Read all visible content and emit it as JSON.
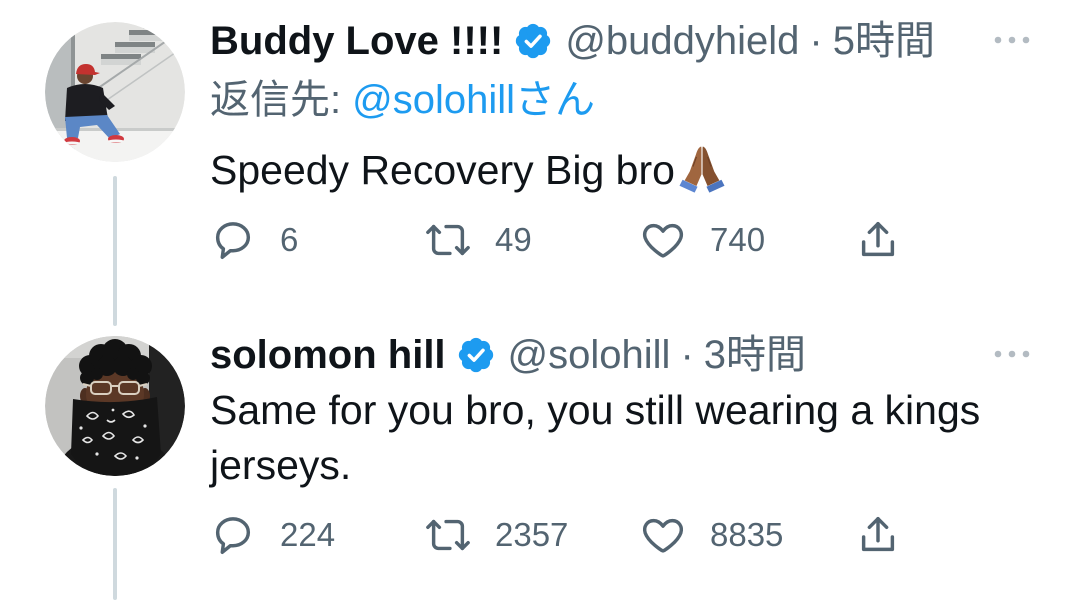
{
  "colors": {
    "background": "#ffffff",
    "text": "#0f1419",
    "secondary": "#536471",
    "link": "#1d9bf0",
    "verified": "#1d9bf0",
    "thread_line": "#cfd9de",
    "more_icon": "#b3bbc2"
  },
  "icons": {
    "more": "more-options-icon",
    "verified": "verified-badge-icon",
    "reply": "reply-icon",
    "retweet": "retweet-icon",
    "like": "heart-icon",
    "share": "share-icon"
  },
  "tweets": [
    {
      "author": {
        "name": "Buddy Love !!!!",
        "handle": "@buddyhield",
        "separator": "·",
        "time": "5時間",
        "avatar": "avatar-buddy-love"
      },
      "reply_to": {
        "label": "返信先:",
        "handle": "@solohillさん"
      },
      "text": "Speedy Recovery Big bro",
      "emoji_icon": "folded-hands-medium-dark-skin-tone-emoji",
      "actions": {
        "replies": "6",
        "retweets": "49",
        "likes": "740"
      }
    },
    {
      "author": {
        "name": "solomon hill",
        "handle": "@solohill",
        "separator": "·",
        "time": "3時間",
        "avatar": "avatar-solomon-hill"
      },
      "text": "Same for you bro, you still wearing a kings jerseys.",
      "actions": {
        "replies": "224",
        "retweets": "2357",
        "likes": "8835"
      }
    }
  ]
}
